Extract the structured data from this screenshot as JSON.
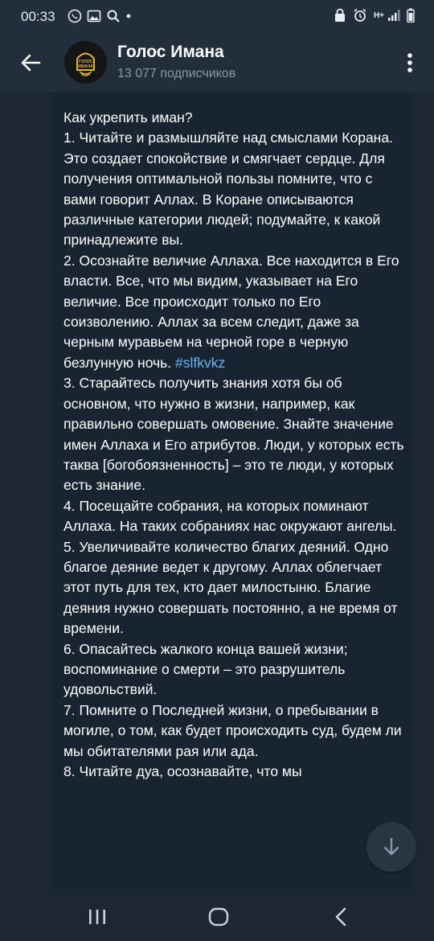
{
  "status_bar": {
    "time": "00:33",
    "left_icons": [
      "whatsapp-icon",
      "image-icon",
      "search-icon",
      "dot-icon"
    ],
    "right_icons": [
      "alarm-lock-icon",
      "alarm-icon",
      "signal-icon",
      "battery-icon"
    ],
    "network": "H+"
  },
  "header": {
    "title": "Голос Имана",
    "subscribers": "13 077 подписчиков",
    "avatar_text": "ГОЛОС ИМАНА"
  },
  "message": {
    "text_before_tag": "Как укрепить иман?\n1. Читайте и размышляйте над смыслами Корана. Это создает спокойствие и смягчает сердце. Для получения оптимальной пользы помните, что с вами говорит Аллах. В Коране описываются различные категории людей; подумайте, к какой принадлежите вы.\n2. Осознайте величие Аллаха. Все находится в Его власти. Все, что мы видим, указывает на Его величие. Все происходит только по Его соизволению. Аллах за всем следит, даже за черным муравьем на черной горе в черную безлунную ночь. ",
    "hashtag": "#slfkvkz",
    "text_after_tag": "\n3. Старайтесь получить знания хотя бы об основном, что нужно в жизни, например, как правильно совершать омовение. Знайте значение имен Аллаха и Его атрибутов. Люди, у которых есть таква [богобоязненность] – это те люди, у которых есть знание.\n4. Посещайте собрания, на которых поминают Аллаха. На таких собраниях нас окружают ангелы.\n5. Увеличивайте количество благих деяний. Одно благое деяние ведет к другому. Аллах облегчает этот путь для тех, кто дает милостыню. Благие деяния нужно совершать постоянно, а не время от времени.\n6. Опасайтесь жалкого конца вашей жизни; воспоминание о смерти – это разрушитель удовольствий.\n7. Помните о Последней жизни, о пребывании в могиле, о том, как будет происходить суд, будем ли мы обитателями рая или ада.\n8. Читайте дуа, осознавайте, что мы"
  },
  "colors": {
    "header_bg": "#232e3c",
    "chat_bg": "#1d2733",
    "bubble_bg": "#192432",
    "hashtag": "#6ab3f3",
    "secondary_text": "#8a99a8"
  },
  "nav": {
    "buttons": [
      "recent-apps-icon",
      "home-icon",
      "back-nav-icon"
    ]
  }
}
